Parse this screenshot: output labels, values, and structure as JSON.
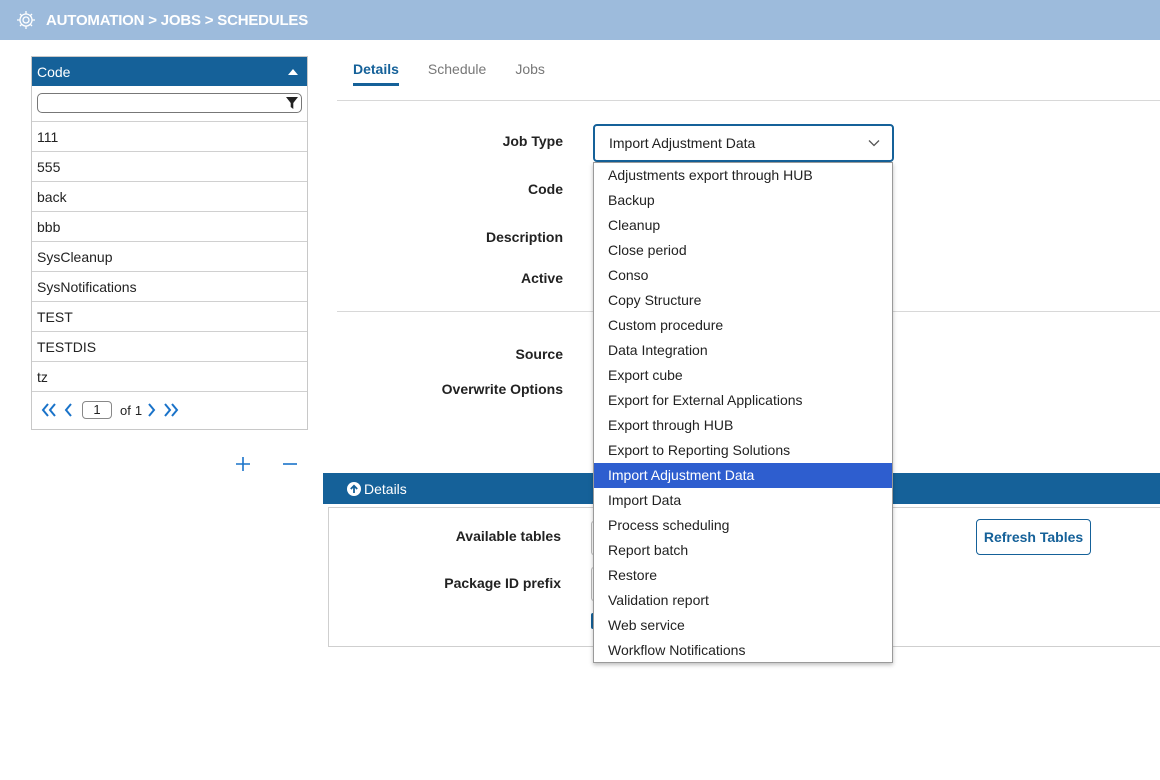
{
  "header": {
    "breadcrumb": "AUTOMATION > JOBS > SCHEDULES",
    "bg_color": "#9dbbdc"
  },
  "list": {
    "column_header": "Code",
    "filter_value": "",
    "rows": [
      "111",
      "555",
      "back",
      "bbb",
      "SysCleanup",
      "SysNotifications",
      "TEST",
      "TESTDIS",
      "tz"
    ],
    "pager": {
      "page": "1",
      "of_label": "of",
      "total": "1"
    }
  },
  "tabs": [
    {
      "label": "Details",
      "active": true
    },
    {
      "label": "Schedule",
      "active": false
    },
    {
      "label": "Jobs",
      "active": false
    }
  ],
  "form": {
    "job_type_label": "Job Type",
    "code_label": "Code",
    "description_label": "Description",
    "active_label": "Active",
    "source_label": "Source",
    "overwrite_label": "Overwrite Options",
    "job_type_value": "Import Adjustment Data"
  },
  "dropdown": {
    "options": [
      "Adjustments export through HUB",
      "Backup",
      "Cleanup",
      "Close period",
      "Conso",
      "Copy Structure",
      "Custom procedure",
      "Data Integration",
      "Export cube",
      "Export for External Applications",
      "Export through HUB",
      "Export to Reporting Solutions",
      "Import Adjustment Data",
      "Import Data",
      "Process scheduling",
      "Report batch",
      "Restore",
      "Validation report",
      "Web service",
      "Workflow Notifications"
    ],
    "selected_index": 12,
    "highlight_color": "#2e5ecf"
  },
  "details": {
    "section_title": "Details",
    "available_tables_label": "Available tables",
    "package_prefix_label": "Package ID prefix",
    "refresh_button": "Refresh Tables"
  },
  "colors": {
    "accent": "#156199"
  }
}
